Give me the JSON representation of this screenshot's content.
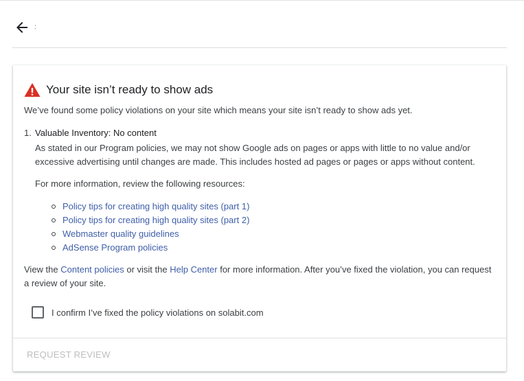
{
  "header": {
    "back_icon": "arrow-left-icon",
    "title": ":"
  },
  "card": {
    "title": "Your site isn’t ready to show ads",
    "warning_icon": "warning-icon",
    "warning_color": "#d93025",
    "intro": "We’ve found some policy violations on your site which means your site isn’t ready to show ads yet.",
    "violation": {
      "number": "1.",
      "title": "Valuable Inventory: No content",
      "description": "As stated in our Program policies, we may not show Google ads on pages or apps with little to no value and/or excessive advertising until changes are made. This includes hosted ad pages or pages or apps without content."
    },
    "more_info": "For more information, review the following resources:",
    "resources": [
      "Policy tips for creating high quality sites (part 1)",
      "Policy tips for creating high quality sites (part 2)",
      "Webmaster quality guidelines",
      "AdSense Program policies"
    ],
    "footer": {
      "view_the": "View the ",
      "content_policies_link": "Content policies",
      "or_visit": " or visit the ",
      "help_center_link": "Help Center",
      "rest": " for more information. After you’ve fixed the violation, you can request a review of your site."
    },
    "confirm_label": "I confirm I’ve fixed the policy violations on solabit.com",
    "confirm_checked": false,
    "request_review_label": "REQUEST REVIEW",
    "link_color": "#3f5ea8"
  }
}
